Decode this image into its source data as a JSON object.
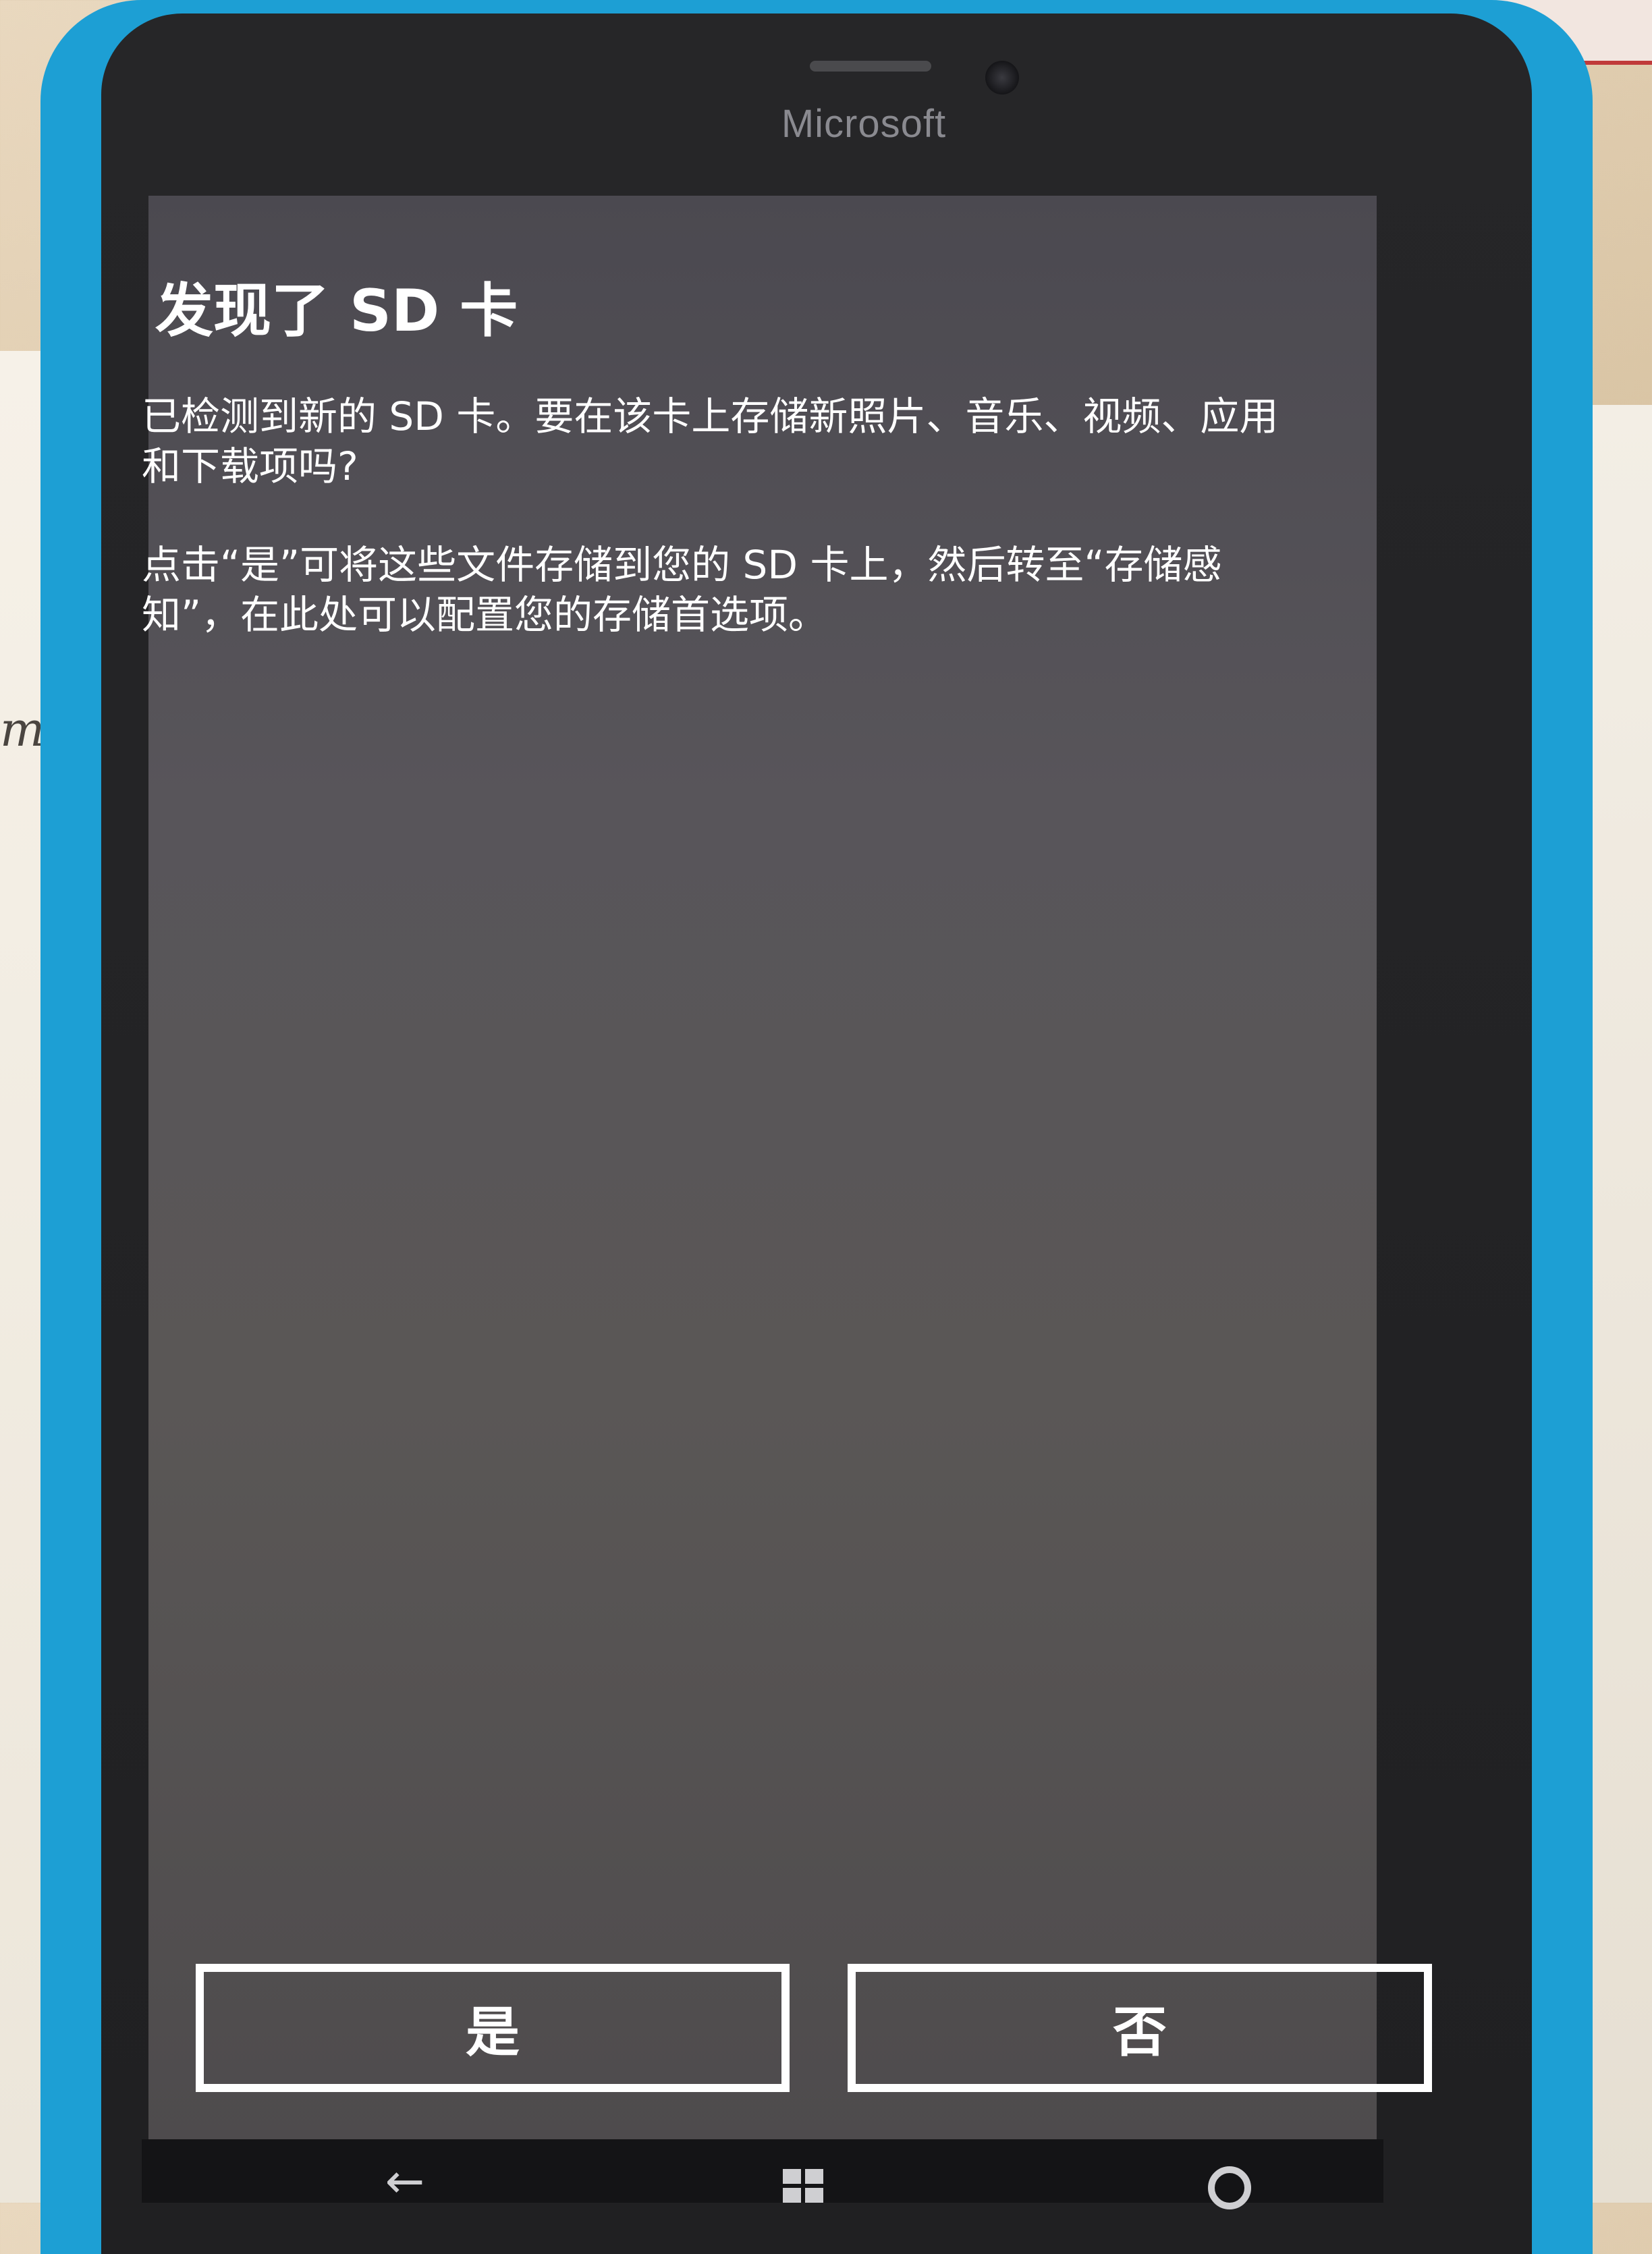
{
  "device": {
    "brand": "Microsoft"
  },
  "background": {
    "handwriting": "mp"
  },
  "dialog": {
    "title": "发现了 SD 卡",
    "paragraph_1": "已检测到新的 SD 卡。要在该卡上存储新照片、音乐、视频、应用和下载项吗?",
    "paragraph_2": "点击“是”可将这些文件存储到您的 SD 卡上，然后转至“存储感知”，在此处可以配置您的存储首选项。",
    "yes_label": "是",
    "no_label": "否"
  },
  "nav": {
    "back_icon": "back-arrow-icon",
    "start_icon": "windows-logo-icon",
    "search_icon": "search-icon"
  },
  "colors": {
    "phone_shell": "#1d9fd4",
    "screen_bg": "#55535a",
    "text": "#ffffff"
  }
}
